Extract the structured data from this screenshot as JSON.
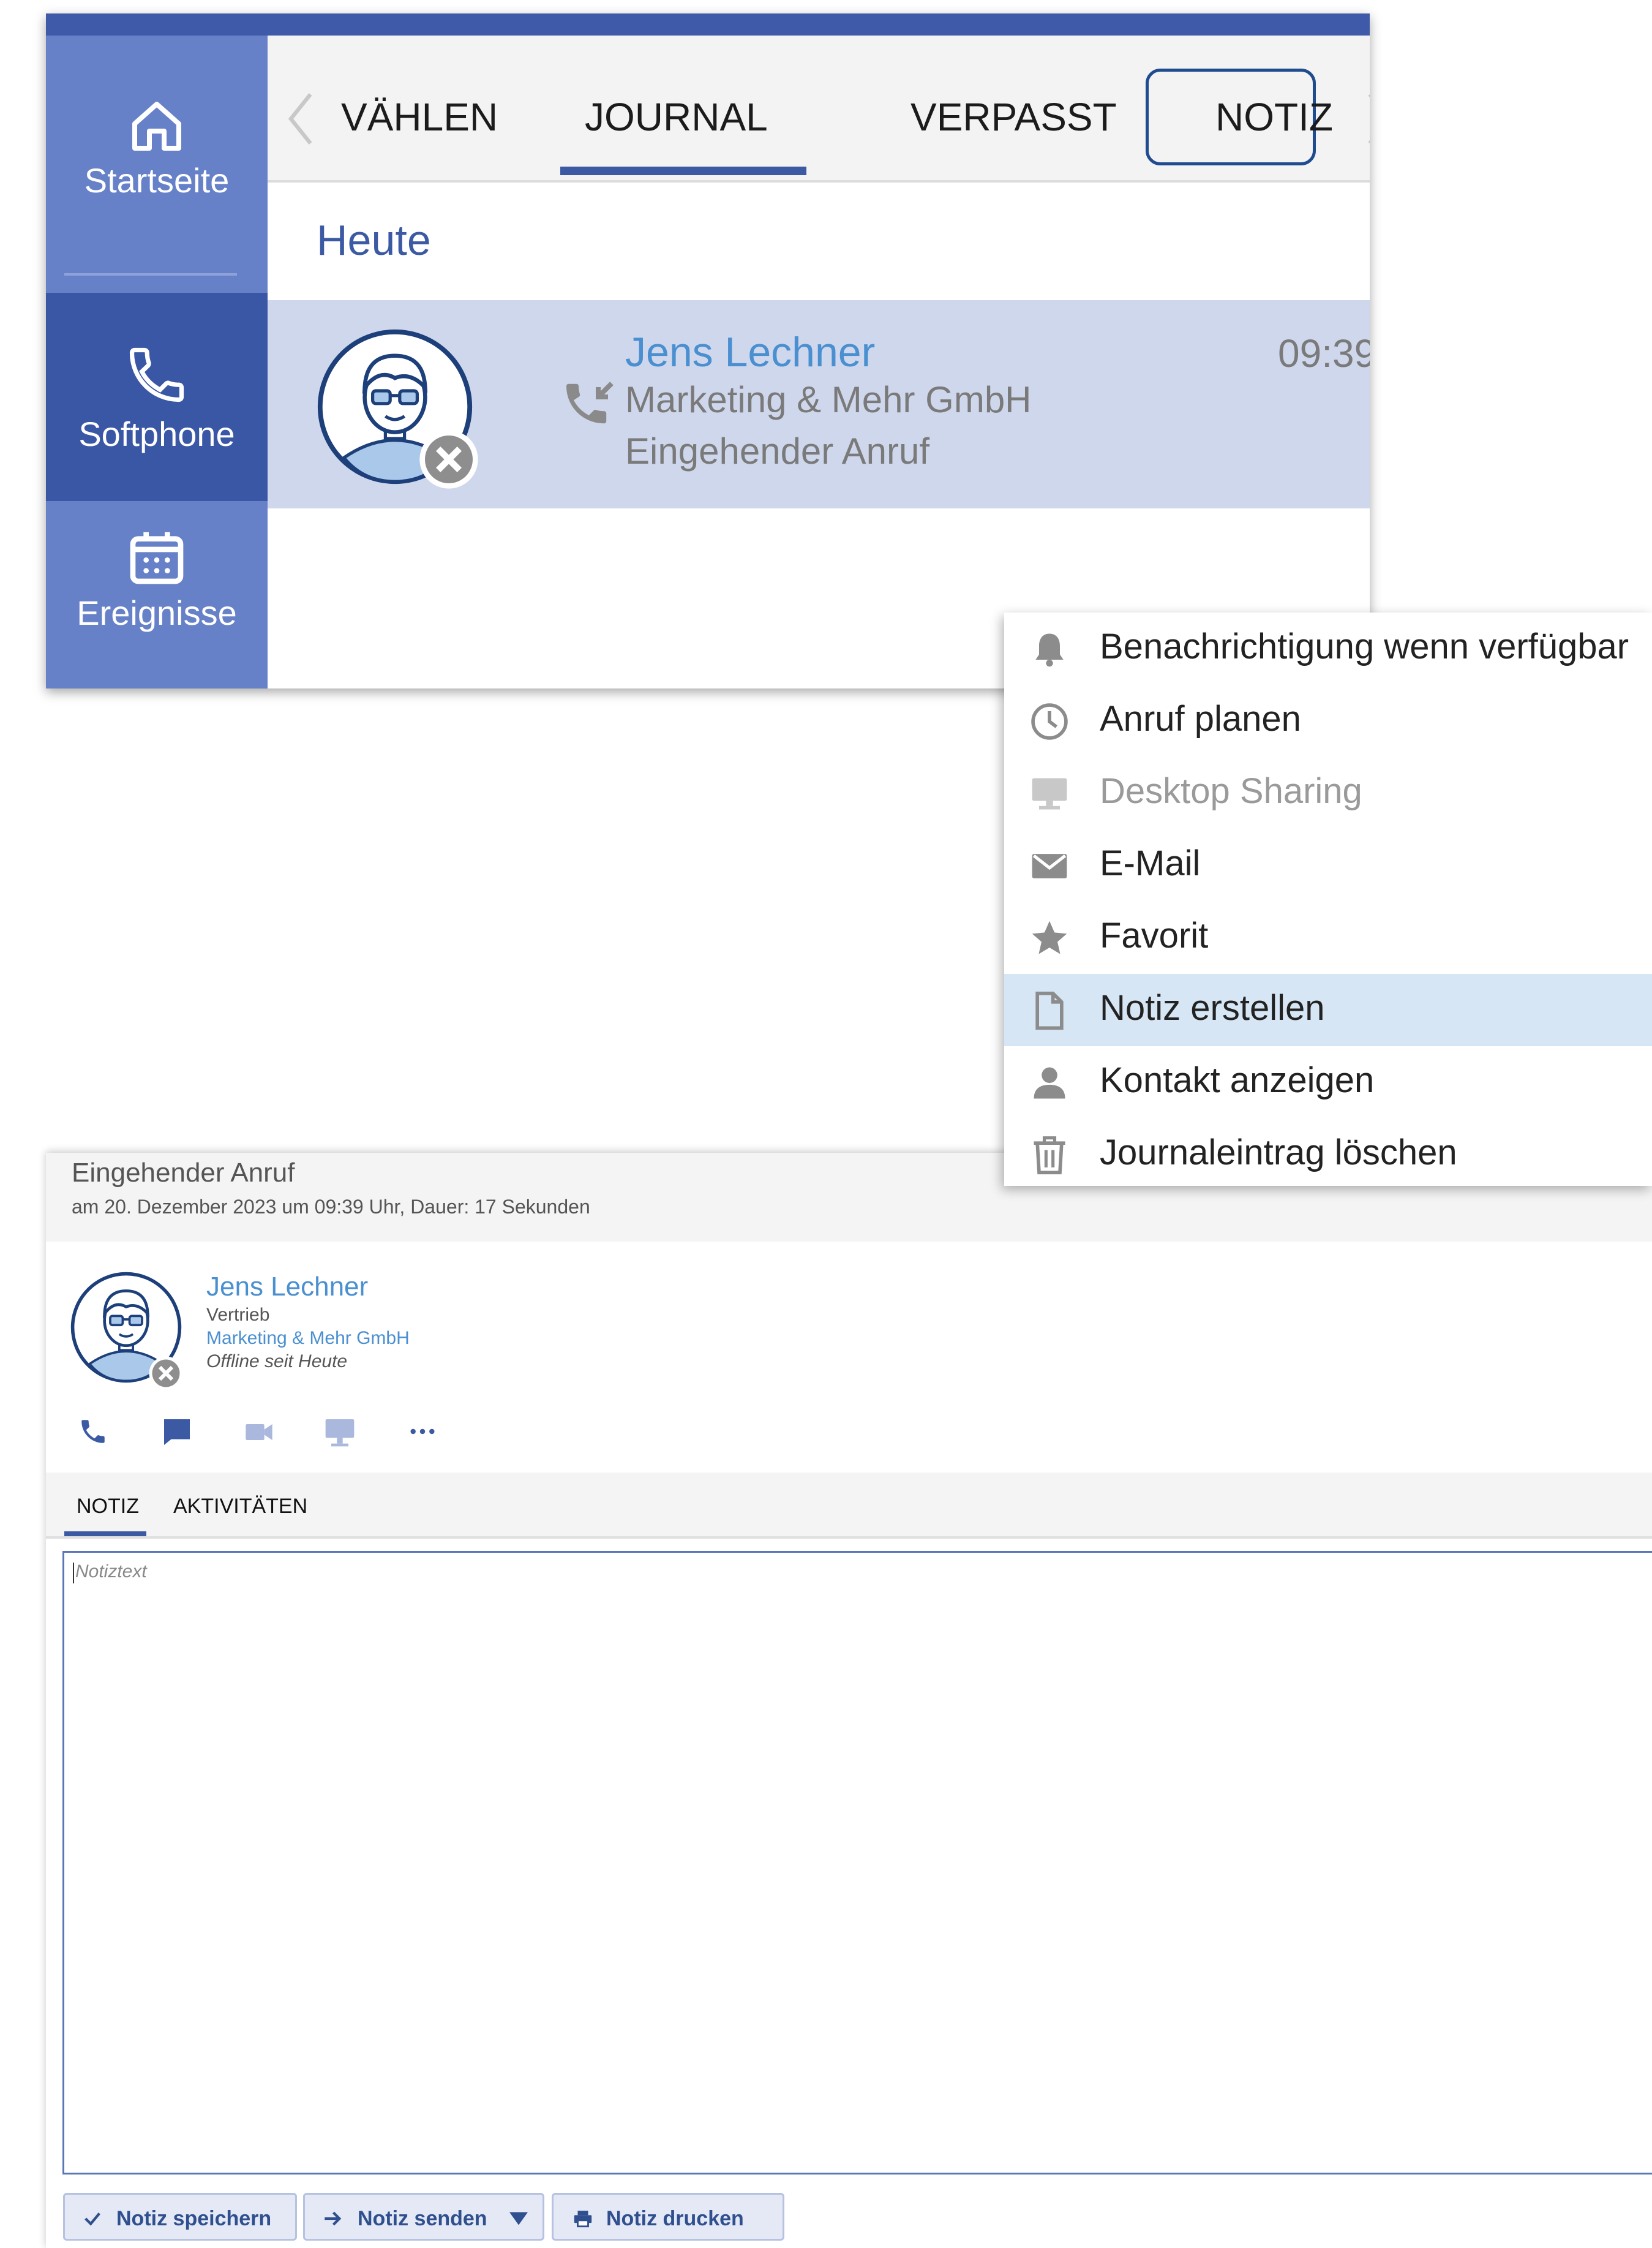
{
  "colors": {
    "accent": "#3b5aa3",
    "sidebar": "#6781c8",
    "sidebar_active": "#3a57a5",
    "row_highlight": "#cfd7ec",
    "menu_selected": "#d6e6f5",
    "name_link": "#4a8fd0"
  },
  "sidebar": {
    "items": [
      {
        "label": "Startseite",
        "icon": "home-icon"
      },
      {
        "label": "Softphone",
        "icon": "phone-icon"
      },
      {
        "label": "Ereignisse",
        "icon": "calendar-icon"
      }
    ]
  },
  "tabs": [
    {
      "label": "VÄHLEN"
    },
    {
      "label": "JOURNAL",
      "active": true
    },
    {
      "label": "VERPASST"
    },
    {
      "label": "NOTIZ",
      "highlighted": true
    }
  ],
  "journal": {
    "section": "Heute",
    "entry": {
      "name": "Jens Lechner",
      "company": "Marketing & Mehr GmbH",
      "type": "Eingehender Anruf",
      "time": "09:39",
      "icon": "incoming-call-icon"
    }
  },
  "context_menu": {
    "items": [
      {
        "label": "Benachrichtigung wenn verfügbar",
        "icon": "bell-icon"
      },
      {
        "label": "Anruf planen",
        "icon": "clock-icon"
      },
      {
        "label": "Desktop Sharing",
        "icon": "monitor-icon",
        "disabled": true
      },
      {
        "label": "E-Mail",
        "icon": "mail-icon"
      },
      {
        "label": "Favorit",
        "icon": "star-icon"
      },
      {
        "label": "Notiz erstellen",
        "icon": "document-icon",
        "selected": true
      },
      {
        "label": "Kontakt anzeigen",
        "icon": "person-icon"
      },
      {
        "label": "Journaleintrag löschen",
        "icon": "trash-icon"
      }
    ]
  },
  "detail": {
    "title": "Eingehender Anruf",
    "subtitle": "am 20. Dezember 2023 um 09:39 Uhr, Dauer: 17 Sekunden",
    "contact": {
      "name": "Jens Lechner",
      "department": "Vertrieb",
      "company": "Marketing & Mehr GmbH",
      "status": "Offline seit Heute"
    },
    "actions": [
      "phone-icon",
      "chat-icon",
      "video-icon",
      "screen-share-icon",
      "more-icon"
    ],
    "tabs": [
      {
        "label": "NOTIZ",
        "active": true
      },
      {
        "label": "AKTIVITÄTEN"
      }
    ],
    "note_placeholder": "Notiztext",
    "buttons": {
      "save": "Notiz speichern",
      "send": "Notiz senden",
      "print": "Notiz drucken"
    }
  }
}
